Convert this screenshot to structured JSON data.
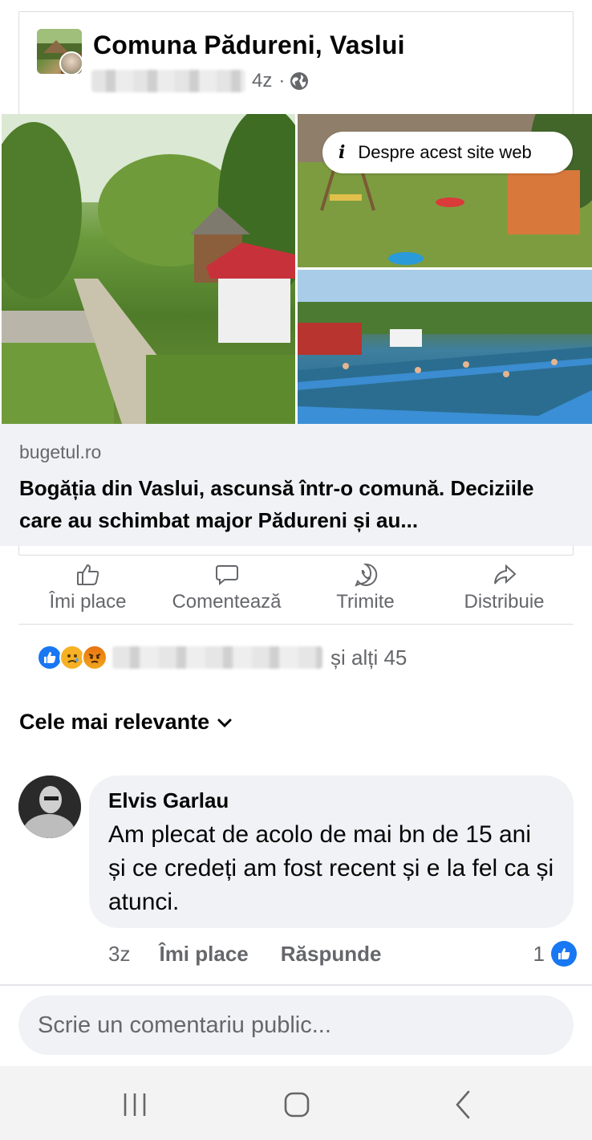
{
  "post": {
    "page_name": "Comuna Pădureni, Vaslui",
    "time": "4z",
    "separator": "·",
    "globe_icon": "globe-icon"
  },
  "preview": {
    "info_label": "Despre acest site web",
    "domain": "bugetul.ro",
    "title": "Bogăția din Vaslui, ascunsă într-o comună. Deciziile care au schimbat major Pădureni și au..."
  },
  "actions": [
    {
      "label": "Îmi place",
      "icon": "thumbs-up-icon"
    },
    {
      "label": "Comentează",
      "icon": "comment-icon"
    },
    {
      "label": "Trimite",
      "icon": "whatsapp-icon"
    },
    {
      "label": "Distribuie",
      "icon": "share-icon"
    }
  ],
  "reactions": {
    "types": [
      "like",
      "sad",
      "angry"
    ],
    "others": "și alți 45"
  },
  "sort": {
    "label": "Cele mai relevante"
  },
  "comment": {
    "author": "Elvis Garlau",
    "text": "Am plecat de acolo de mai bn de 15 ani și ce credeți am fost recent și e la fel ca și atunci.",
    "time": "3z",
    "like_label": "Îmi place",
    "reply_label": "Răspunde",
    "like_count": "1"
  },
  "composer": {
    "placeholder": "Scrie un comentariu public..."
  },
  "colors": {
    "accent": "#1877f2",
    "secondary_text": "#65676b",
    "bubble": "#f0f2f5"
  }
}
